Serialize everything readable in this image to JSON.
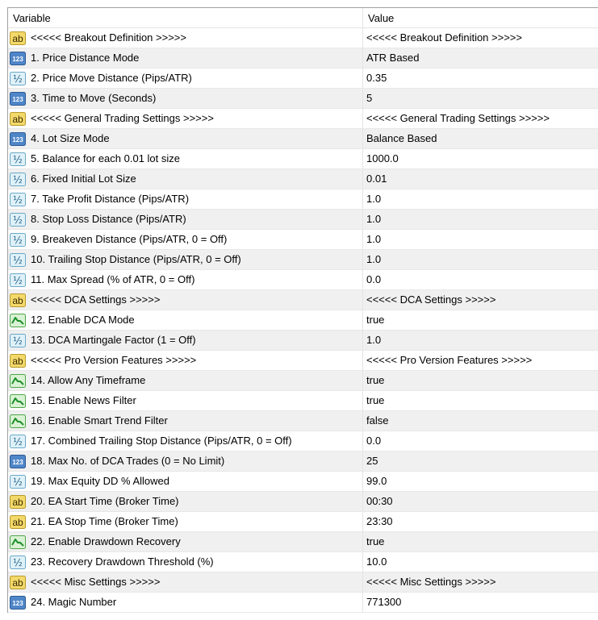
{
  "header": {
    "variable": "Variable",
    "value": "Value"
  },
  "rows": [
    {
      "icon": "ab",
      "name": "<<<<< Breakout Definition >>>>>",
      "value": "<<<<< Breakout Definition >>>>>"
    },
    {
      "icon": "int",
      "name": "1. Price Distance Mode",
      "value": "ATR Based"
    },
    {
      "icon": "frac",
      "name": "2. Price Move Distance (Pips/ATR)",
      "value": "0.35"
    },
    {
      "icon": "int",
      "name": "3. Time to Move (Seconds)",
      "value": "5"
    },
    {
      "icon": "ab",
      "name": "<<<<< General Trading Settings >>>>>",
      "value": "<<<<< General Trading Settings >>>>>"
    },
    {
      "icon": "int",
      "name": "4. Lot Size Mode",
      "value": "Balance Based"
    },
    {
      "icon": "frac",
      "name": "5. Balance for each 0.01 lot size",
      "value": "1000.0"
    },
    {
      "icon": "frac",
      "name": "6. Fixed Initial Lot Size",
      "value": "0.01"
    },
    {
      "icon": "frac",
      "name": "7. Take Profit Distance (Pips/ATR)",
      "value": "1.0"
    },
    {
      "icon": "frac",
      "name": "8. Stop Loss Distance (Pips/ATR)",
      "value": "1.0"
    },
    {
      "icon": "frac",
      "name": "9. Breakeven Distance (Pips/ATR, 0 = Off)",
      "value": "1.0"
    },
    {
      "icon": "frac",
      "name": "10. Trailing Stop Distance (Pips/ATR, 0 = Off)",
      "value": "1.0"
    },
    {
      "icon": "frac",
      "name": "11. Max Spread (% of ATR, 0 = Off)",
      "value": "0.0"
    },
    {
      "icon": "ab",
      "name": "<<<<< DCA Settings >>>>>",
      "value": "<<<<< DCA Settings >>>>>"
    },
    {
      "icon": "bool",
      "name": "12. Enable DCA Mode",
      "value": "true"
    },
    {
      "icon": "frac",
      "name": "13. DCA Martingale Factor (1 = Off)",
      "value": "1.0"
    },
    {
      "icon": "ab",
      "name": "<<<<< Pro Version Features >>>>>",
      "value": "<<<<< Pro Version Features >>>>>"
    },
    {
      "icon": "bool",
      "name": "14. Allow Any Timeframe",
      "value": "true"
    },
    {
      "icon": "bool",
      "name": "15. Enable News Filter",
      "value": "true"
    },
    {
      "icon": "bool",
      "name": "16. Enable Smart Trend Filter",
      "value": "false"
    },
    {
      "icon": "frac",
      "name": "17. Combined Trailing Stop Distance (Pips/ATR, 0 = Off)",
      "value": "0.0"
    },
    {
      "icon": "int",
      "name": "18. Max No. of DCA Trades (0 = No Limit)",
      "value": "25"
    },
    {
      "icon": "frac",
      "name": "19. Max Equity DD % Allowed",
      "value": "99.0"
    },
    {
      "icon": "ab",
      "name": "20. EA Start Time (Broker Time)",
      "value": "00:30"
    },
    {
      "icon": "ab",
      "name": "21. EA Stop Time (Broker Time)",
      "value": "23:30"
    },
    {
      "icon": "bool",
      "name": "22. Enable Drawdown Recovery",
      "value": "true"
    },
    {
      "icon": "frac",
      "name": "23. Recovery Drawdown Threshold (%)",
      "value": "10.0"
    },
    {
      "icon": "ab",
      "name": "<<<<< Misc Settings >>>>>",
      "value": "<<<<< Misc Settings >>>>>"
    },
    {
      "icon": "int",
      "name": "24. Magic Number",
      "value": "771300"
    }
  ],
  "icon_labels": {
    "ab": "ab",
    "int": "123",
    "frac": "½"
  },
  "colors": {
    "ab_fill": "#f3d96a",
    "ab_border": "#b89a2a",
    "int_fill": "#4f86c8",
    "int_border": "#2c5a94",
    "frac_fill": "#dff1f8",
    "frac_border": "#6aa9c6",
    "bool_fill": "#d9f2d4",
    "bool_border": "#4ea64a",
    "bool_stroke": "#1f8f2b"
  }
}
